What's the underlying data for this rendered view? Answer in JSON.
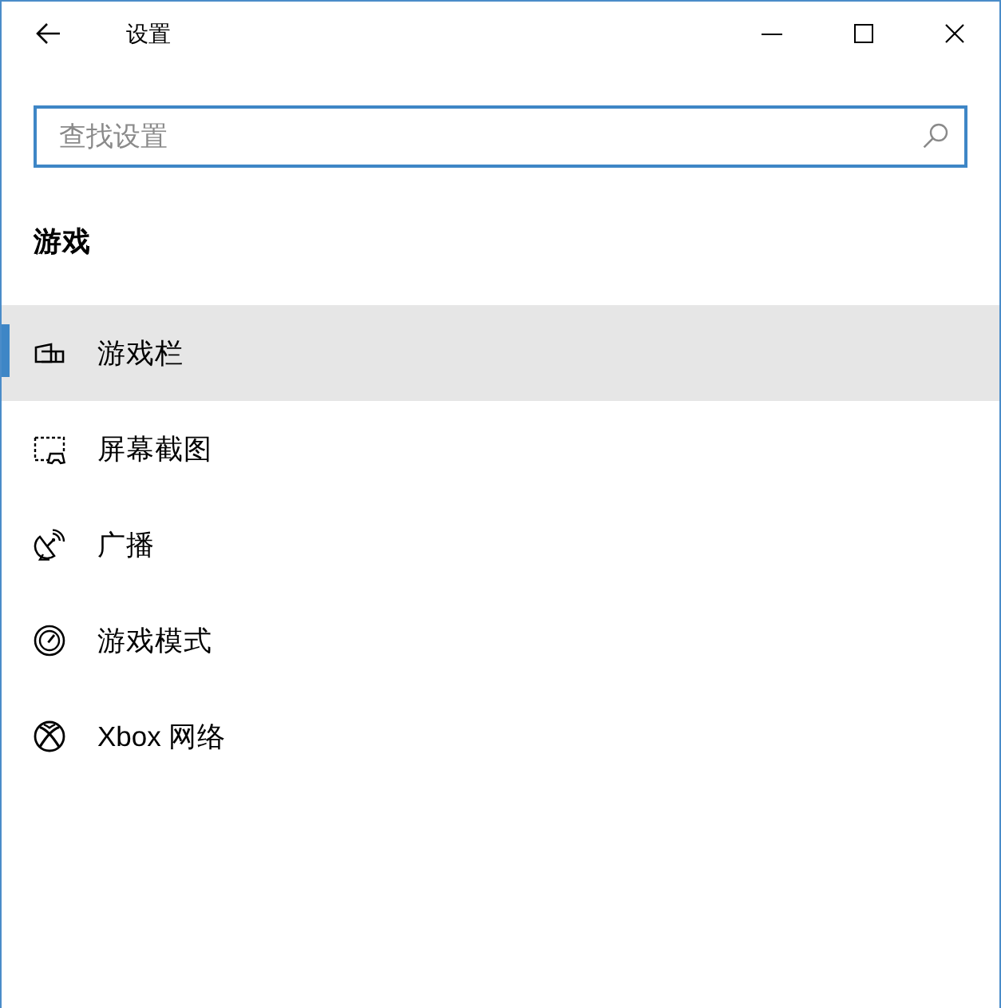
{
  "window": {
    "title": "设置"
  },
  "search": {
    "placeholder": "查找设置"
  },
  "section": {
    "title": "游戏"
  },
  "sidebar": {
    "items": [
      {
        "label": "游戏栏",
        "selected": true
      },
      {
        "label": "屏幕截图",
        "selected": false
      },
      {
        "label": "广播",
        "selected": false
      },
      {
        "label": "游戏模式",
        "selected": false
      },
      {
        "label": "Xbox 网络",
        "selected": false
      }
    ]
  }
}
